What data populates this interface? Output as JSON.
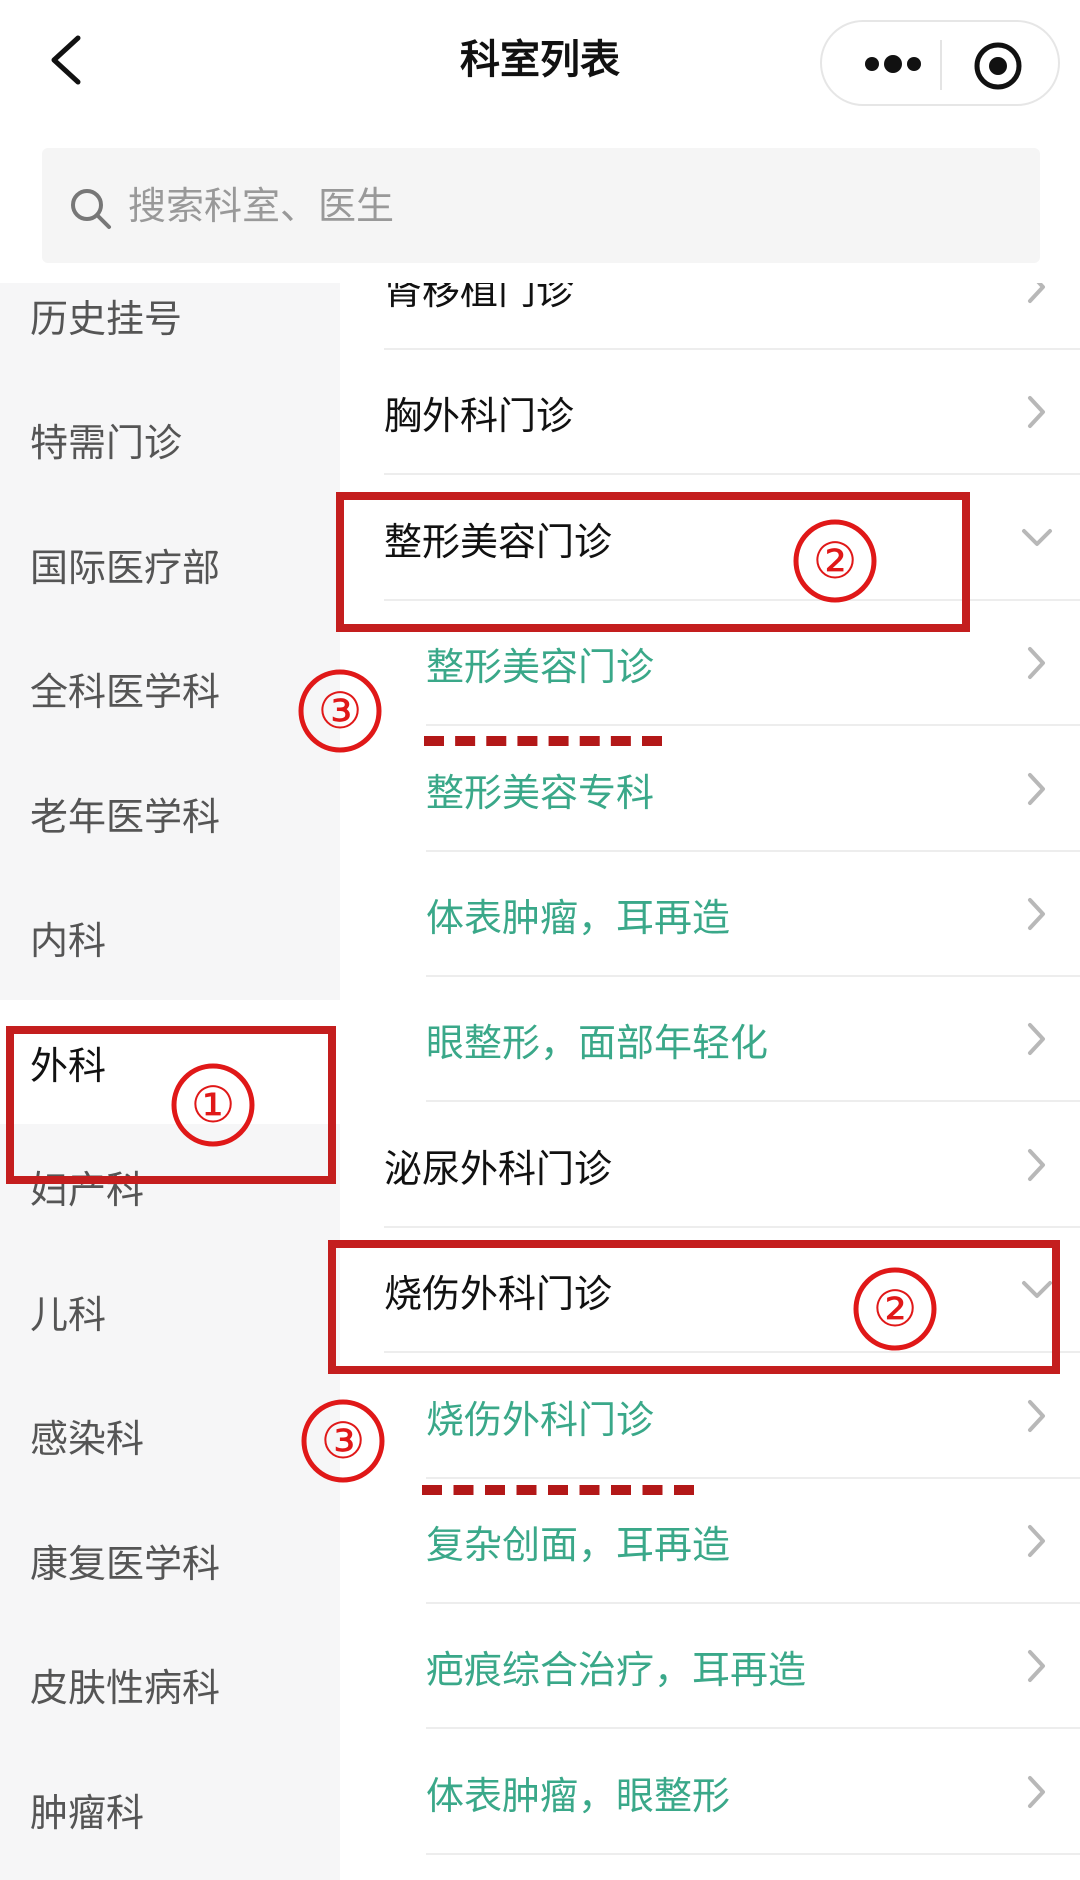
{
  "header": {
    "title": "科室列表",
    "back_icon": "back-chevron-icon",
    "more_icon": "more-dots-icon",
    "target_icon": "target-circle-icon"
  },
  "search": {
    "placeholder": "搜索科室、医生",
    "icon": "search-icon"
  },
  "sidebar": {
    "items": [
      {
        "label": "历史挂号"
      },
      {
        "label": "特需门诊"
      },
      {
        "label": "国际医疗部"
      },
      {
        "label": "全科医学科"
      },
      {
        "label": "老年医学科"
      },
      {
        "label": "内科"
      },
      {
        "label": "外科",
        "active": true
      },
      {
        "label": "妇产科"
      },
      {
        "label": "儿科"
      },
      {
        "label": "感染科"
      },
      {
        "label": "康复医学科"
      },
      {
        "label": "皮肤性病科"
      },
      {
        "label": "肿瘤科"
      }
    ]
  },
  "departments": [
    {
      "label": "肾移植门诊",
      "level": 1,
      "icon": "chevron-right-icon"
    },
    {
      "label": "胸外科门诊",
      "level": 1,
      "icon": "chevron-right-icon"
    },
    {
      "label": "整形美容门诊",
      "level": 1,
      "icon": "chevron-down-icon",
      "expanded": true
    },
    {
      "label": "整形美容门诊",
      "level": 2,
      "icon": "chevron-right-icon"
    },
    {
      "label": "整形美容专科",
      "level": 2,
      "icon": "chevron-right-icon"
    },
    {
      "label": "体表肿瘤，耳再造",
      "level": 2,
      "icon": "chevron-right-icon"
    },
    {
      "label": "眼整形，面部年轻化",
      "level": 2,
      "icon": "chevron-right-icon"
    },
    {
      "label": "泌尿外科门诊",
      "level": 1,
      "icon": "chevron-right-icon"
    },
    {
      "label": "烧伤外科门诊",
      "level": 1,
      "icon": "chevron-down-icon",
      "expanded": true
    },
    {
      "label": "烧伤外科门诊",
      "level": 2,
      "icon": "chevron-right-icon"
    },
    {
      "label": "复杂创面，耳再造",
      "level": 2,
      "icon": "chevron-right-icon"
    },
    {
      "label": "疤痕综合治疗，耳再造",
      "level": 2,
      "icon": "chevron-right-icon"
    },
    {
      "label": "体表肿瘤，眼整形",
      "level": 2,
      "icon": "chevron-right-icon"
    }
  ],
  "annotations": {
    "step1": "①",
    "step2": "②",
    "step3": "③",
    "color": "#c41e1e"
  },
  "colors": {
    "sub_item": "#3aa889",
    "sidebar_bg": "#f6f6f7"
  }
}
